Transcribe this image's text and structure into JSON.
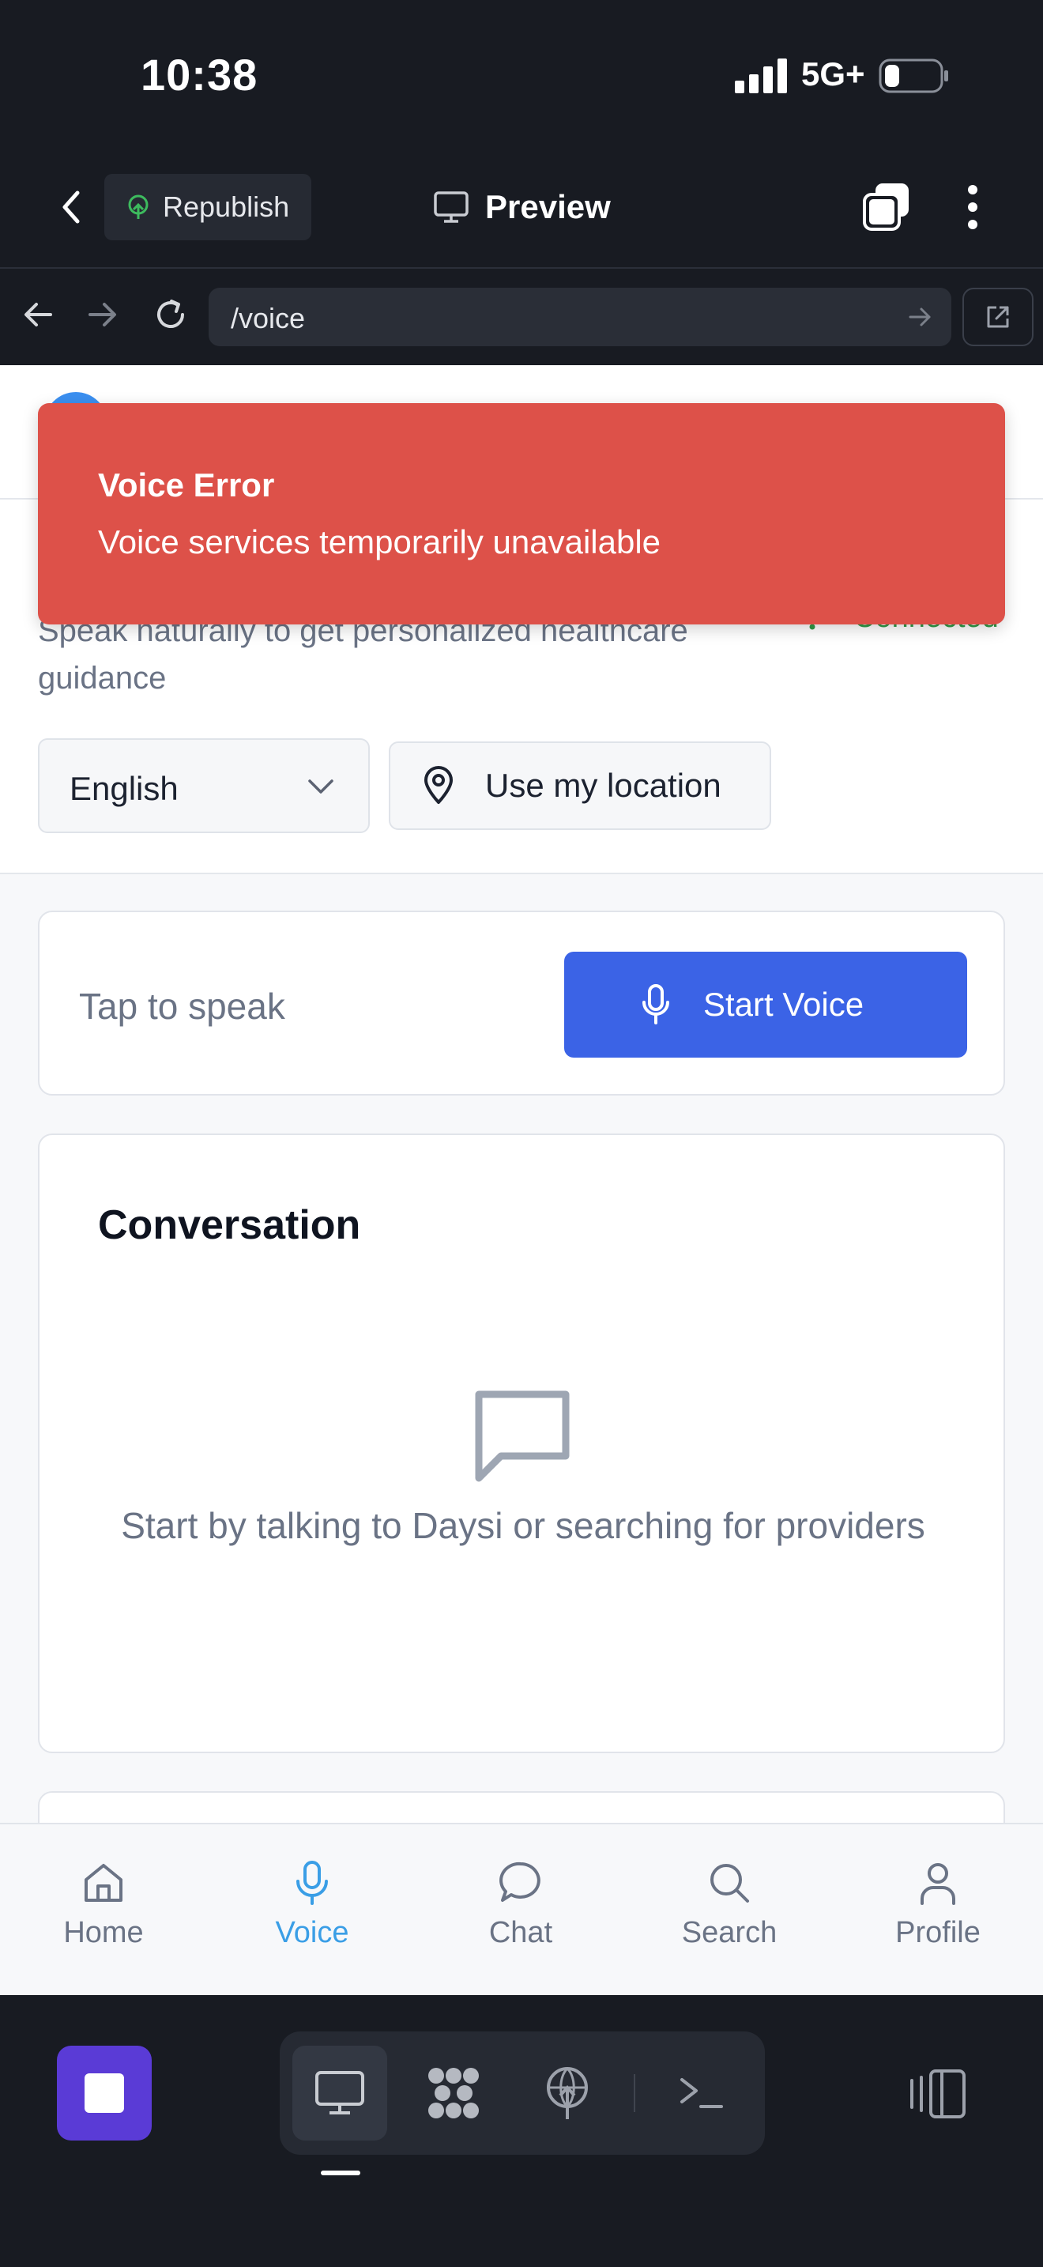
{
  "status_bar": {
    "time": "10:38",
    "network": "5G+"
  },
  "app_header": {
    "republish_label": "Republish",
    "preview_label": "Preview"
  },
  "browser": {
    "url": "/voice"
  },
  "page": {
    "subtitle": "Speak naturally to get personalized healthcare guidance",
    "connection_status": "Connected",
    "language": {
      "selected": "English"
    },
    "location_button": "Use my location",
    "speak_card": {
      "hint": "Tap to speak",
      "start_button": "Start Voice"
    },
    "conversation": {
      "title": "Conversation",
      "empty_message": "Start by talking to Daysi or searching for providers"
    }
  },
  "toast": {
    "title": "Voice Error",
    "message": "Voice services temporarily unavailable"
  },
  "tab_bar": {
    "items": [
      {
        "label": "Home",
        "icon": "home-icon"
      },
      {
        "label": "Voice",
        "icon": "mic-icon",
        "active": true
      },
      {
        "label": "Chat",
        "icon": "chat-bubble-icon"
      },
      {
        "label": "Search",
        "icon": "search-icon"
      },
      {
        "label": "Profile",
        "icon": "user-icon"
      }
    ]
  },
  "dock": {
    "items": [
      "monitor-icon",
      "apps-icon",
      "deploy-icon",
      "terminal-icon"
    ]
  },
  "colors": {
    "toast_bg": "#dd5149",
    "primary_button": "#3b63e6",
    "active_tab": "#3a9ee6",
    "connected": "#2f9a47",
    "stop_button": "#5a3bd6"
  }
}
